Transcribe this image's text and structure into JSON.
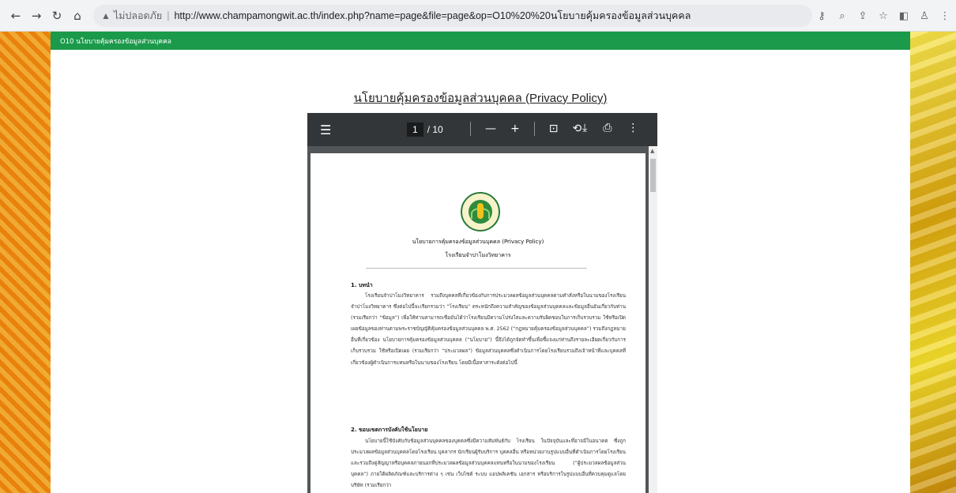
{
  "browser": {
    "security_warning": "ไม่ปลอดภัย",
    "separator": "|",
    "url": "http://www.champamongwit.ac.th/index.php?name=page&file=page&op=O10%20%20นโยบายคุ้มครองข้อมูลส่วนบุคคล"
  },
  "site": {
    "breadcrumb": "O10 นโยบายคุ้มครองข้อมูลส่วนบุคคล",
    "heading": "นโยบายคุ้มครองข้อมูลส่วนบุคคล (Privacy Policy)"
  },
  "pdf_viewer": {
    "current_page": "1",
    "total_pages": "/ 10"
  },
  "document": {
    "title": "นโยบายการคุ้มครองข้อมูลส่วนบุคคล (Privacy Policy)",
    "subtitle": "โรงเรียนจำปาโมงวิทยาคาร",
    "sections": [
      {
        "heading": "1. บทนำ",
        "body": "โรงเรียนจำปาโมงวิทยาคาร รวมถึงบุคคลที่เกี่ยวข้องกับการประมวลผลข้อมูลส่วนบุคคลตามคำสั่งหรือในนามของโรงเรียนจำปาโมงวิทยาคาร ซึ่งต่อไปนี้จะเรียกรวมว่า “โรงเรียน” ตระหนักถึงความสำคัญของข้อมูลส่วนบุคคลและข้อมูลอื่นอันเกี่ยวกับท่าน (รวมเรียกว่า “ข้อมูล”) เพื่อให้ท่านสามารถเชื่อมั่นได้ว่าโรงเรียนมีความโปร่งใสและความรับผิดชอบในการเก็บรวบรวม ใช้หรือเปิดเผยข้อมูลของท่านตามพระราชบัญญัติคุ้มครองข้อมูลส่วนบุคคล พ.ศ. 2562 (“กฎหมายคุ้มครองข้อมูลส่วนบุคคล”) รวมถึงกฎหมายอื่นที่เกี่ยวข้อง นโยบายการคุ้มครองข้อมูลส่วนบุคคล (“นโยบาย”) นี้จึงได้ถูกจัดทำขึ้นเพื่อชี้แจงแก่ท่านถึงรายละเอียดเกี่ยวกับการเก็บรวบรวม ใช้หรือเปิดเผย (รวมเรียกว่า “ประมวลผล”) ข้อมูลส่วนบุคคลซึ่งดำเนินการโดยโรงเรียนรวมถึงเจ้าหน้าที่และบุคคลที่เกี่ยวข้องผู้ดำเนินการแทนหรือในนามของโรงเรียน โดยมีเนื้อหาสาระดังต่อไปนี้"
      },
      {
        "heading": "2. ขอบเขตการบังคับใช้นโยบาย",
        "body": "นโยบายนี้ใช้บังคับกับข้อมูลส่วนบุคคลของบุคคลซึ่งมีความสัมพันธ์กับ โรงเรียน ในปัจจุบันและที่อาจมีในอนาคต ซึ่งถูกประมวลผลข้อมูลส่วนบุคคลโดยโรงเรียน บุคลากร นักเรียนผู้รับบริการ บุคคลอื่น หรือหน่วยงานรูปแบบอื่นที่ดำเนินการโดยโรงเรียน และรวมถึงคู่สัญญาหรือบุคคลภายนอกที่ประมวลผลข้อมูลส่วนบุคคลแทนหรือในนามของโรงเรียน (“ผู้ประมวลผลข้อมูลส่วนบุคคล”) ภายใต้ผลิตภัณฑ์และบริการต่าง ๆ เช่น เว็บไซต์ ระบบ แอปพลิเคชัน เอกสาร หรือบริการในรูปแบบอื่นที่ควบคุมดูแลโดย บริษัท (รวมเรียกว่า"
      }
    ]
  }
}
